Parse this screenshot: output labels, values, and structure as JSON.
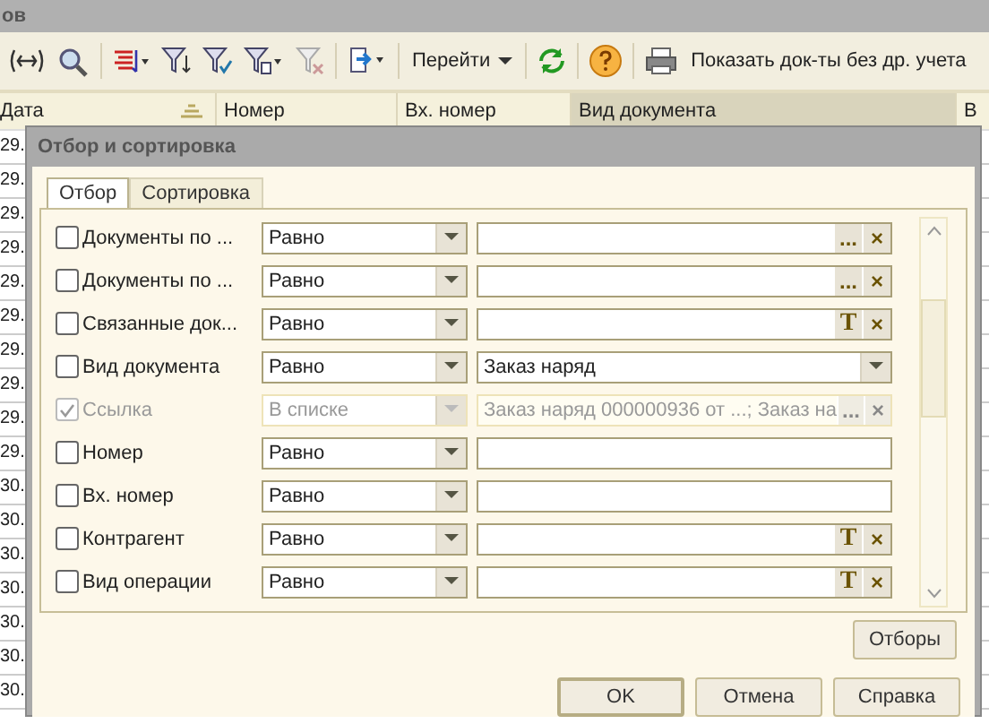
{
  "app": {
    "title": "ов",
    "toolbar": {
      "goto": "Перейти",
      "show_button": "Показать док-ты без др. учета"
    }
  },
  "table": {
    "columns": [
      {
        "label": "Дата",
        "selected": false
      },
      {
        "label": "Номер",
        "selected": false
      },
      {
        "label": "Вх. номер",
        "selected": false
      },
      {
        "label": "Вид документа",
        "selected": true
      },
      {
        "label": "В",
        "selected": false
      }
    ],
    "rows": [
      "29.",
      "29.",
      "29.",
      "29.",
      "29.",
      "29.",
      "29.",
      "29.",
      "29.",
      "29.",
      "30.",
      "30.",
      "30.",
      "30.",
      "30.",
      "30.",
      "30."
    ]
  },
  "dialog": {
    "title": "Отбор и сортировка",
    "tabs": [
      {
        "label": "Отбор",
        "selected": true
      },
      {
        "label": "Сортировка",
        "selected": false
      }
    ],
    "filters": [
      {
        "label": "Документы по ...",
        "checked": false,
        "disabled": false,
        "comparison": "Равно",
        "kind": "choice",
        "buttons": [
          "...",
          "×"
        ]
      },
      {
        "label": "Документы по ...",
        "checked": false,
        "disabled": false,
        "comparison": "Равно",
        "kind": "choice",
        "buttons": [
          "...",
          "×"
        ]
      },
      {
        "label": "Связанные док...",
        "checked": false,
        "disabled": false,
        "comparison": "Равно",
        "kind": "choice",
        "buttons": [
          "T",
          "×"
        ]
      },
      {
        "label": "Вид документа",
        "checked": false,
        "disabled": false,
        "comparison": "Равно",
        "kind": "dropdown",
        "value": "Заказ наряд"
      },
      {
        "label": "Ссылка",
        "checked": true,
        "disabled": true,
        "comparison": "В списке",
        "kind": "choice",
        "value": "Заказ наряд 000000936 от ...; Заказ на",
        "buttons": [
          "...",
          "×"
        ]
      },
      {
        "label": "Номер",
        "checked": false,
        "disabled": false,
        "comparison": "Равно",
        "kind": "text"
      },
      {
        "label": "Вх. номер",
        "checked": false,
        "disabled": false,
        "comparison": "Равно",
        "kind": "text"
      },
      {
        "label": "Контрагент",
        "checked": false,
        "disabled": false,
        "comparison": "Равно",
        "kind": "choice",
        "buttons": [
          "T",
          "×"
        ]
      },
      {
        "label": "Вид операции",
        "checked": false,
        "disabled": false,
        "comparison": "Равно",
        "kind": "choice",
        "buttons": [
          "T",
          "×"
        ]
      }
    ],
    "filters_button": "Отборы",
    "buttons": [
      "OK",
      "Отмена",
      "Справка"
    ]
  }
}
